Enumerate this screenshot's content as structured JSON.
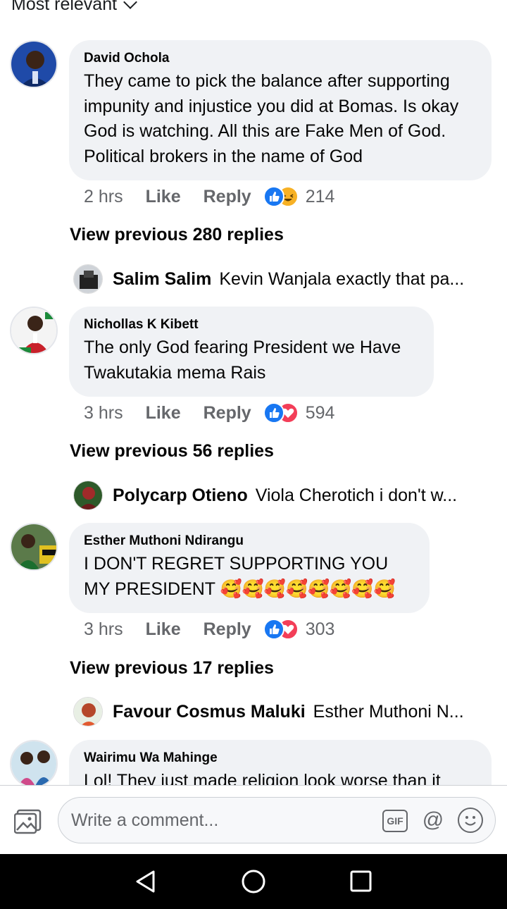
{
  "sort": {
    "label": "Most relevant"
  },
  "comments": [
    {
      "author": "David Ochola",
      "text": "They came to pick the balance after supporting impunity and injustice you did at Bomas. Is okay God is watching. All this are Fake Men of God. Political brokers in the name of God",
      "time": "2 hrs",
      "like_label": "Like",
      "reply_label": "Reply",
      "reactions": [
        "like",
        "haha"
      ],
      "reaction_count": "214",
      "view_previous": "View previous 280 replies",
      "last_reply": {
        "name": "Salim Salim",
        "text": "Kevin Wanjala exactly that pa..."
      }
    },
    {
      "author": "Nichollas K Kibett",
      "text": "The only God fearing President we Have Twakutakia  mema Rais",
      "time": "3 hrs",
      "like_label": "Like",
      "reply_label": "Reply",
      "reactions": [
        "like",
        "love"
      ],
      "reaction_count": "594",
      "view_previous": "View previous 56 replies",
      "last_reply": {
        "name": "Polycarp Otieno",
        "text": "Viola Cherotich i don't w..."
      }
    },
    {
      "author": "Esther Muthoni Ndirangu",
      "text": "I DON'T REGRET SUPPORTING YOU MY PRESIDENT 🥰🥰🥰🥰🥰🥰🥰🥰",
      "time": "3 hrs",
      "like_label": "Like",
      "reply_label": "Reply",
      "reactions": [
        "like",
        "love"
      ],
      "reaction_count": "303",
      "view_previous": "View previous 17 replies",
      "last_reply": {
        "name": "Favour Cosmus Maluki",
        "text": "Esther Muthoni N..."
      }
    },
    {
      "author": "Wairimu Wa Mahinge",
      "text": "Lol! They just made religion look worse than it"
    }
  ],
  "composer": {
    "placeholder": "Write a comment...",
    "gif_label": "GIF",
    "at_label": "@"
  },
  "colors": {
    "bubble": "#f0f2f5",
    "like_blue": "#1877f2",
    "love_red": "#f33e58",
    "secondary_text": "#65676b"
  }
}
